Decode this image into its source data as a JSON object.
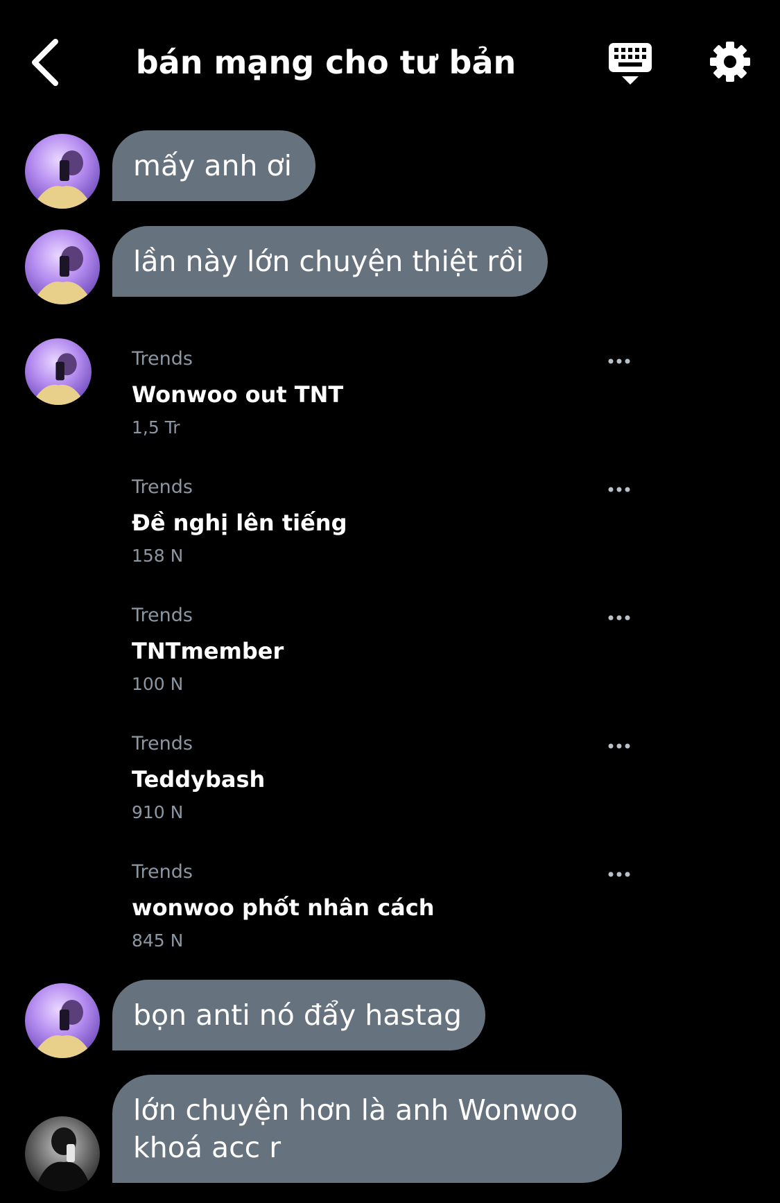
{
  "header": {
    "title": "bán mạng cho tư bản",
    "back_icon": "chevron-left-icon",
    "keyboard_icon": "keyboard-icon",
    "settings_icon": "gear-icon"
  },
  "messages": [
    {
      "text": "mấy anh ơi",
      "avatar": "avatar-purple"
    },
    {
      "text": "lần này lớn chuyện thiệt rồi",
      "avatar": "avatar-purple"
    },
    {
      "text": "bọn anti nó đẩy hastag",
      "avatar": "avatar-purple"
    },
    {
      "text": "lớn chuyện hơn là anh Wonwoo khoá acc r",
      "avatar": "avatar-dark"
    }
  ],
  "trends": [
    {
      "category": "Trends",
      "name": "Wonwoo out TNT",
      "count": "1,5 Tr"
    },
    {
      "category": "Trends",
      "name": "Đề nghị lên tiếng",
      "count": "158 N"
    },
    {
      "category": "Trends",
      "name": "TNTmember",
      "count": "100 N"
    },
    {
      "category": "Trends",
      "name": "Teddybash",
      "count": "910 N"
    },
    {
      "category": "Trends",
      "name": "wonwoo phốt nhân cách",
      "count": "845 N"
    }
  ],
  "colors": {
    "background": "#000000",
    "bubble": "#66727e",
    "secondary_text": "#8b97a3"
  }
}
